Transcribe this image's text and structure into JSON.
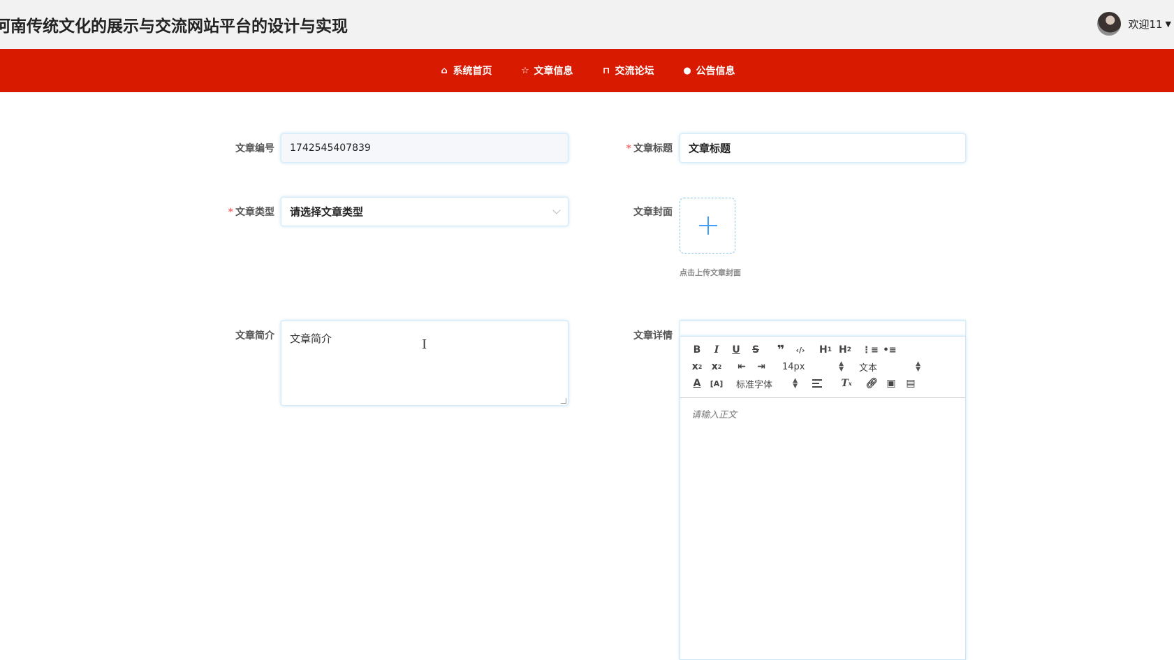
{
  "header": {
    "title": "河南传统文化的展示与交流网站平台的设计与实现",
    "welcome": "欢迎11",
    "caret": "▼"
  },
  "nav": {
    "items": [
      {
        "label": "系统首页",
        "icon": "home-icon",
        "glyph": "⌂"
      },
      {
        "label": "文章信息",
        "icon": "star-icon",
        "glyph": "☆"
      },
      {
        "label": "交流论坛",
        "icon": "bag-icon",
        "glyph": "⊓"
      },
      {
        "label": "公告信息",
        "icon": "info-icon",
        "glyph": "●"
      }
    ]
  },
  "form": {
    "id_label": "文章编号",
    "id_value": "1742545407839",
    "title_label": "文章标题",
    "title_value": "文章标题",
    "type_label": "文章类型",
    "type_placeholder": "请选择文章类型",
    "cover_label": "文章封面",
    "cover_tip": "点击上传文章封面",
    "intro_label": "文章简介",
    "intro_value": "文章简介",
    "detail_label": "文章详情",
    "required_mark": "*"
  },
  "editor": {
    "size_value": "14px",
    "header_value": "文本",
    "font_value": "标准字体",
    "placeholder": "请输入正文"
  },
  "cursor": "I"
}
